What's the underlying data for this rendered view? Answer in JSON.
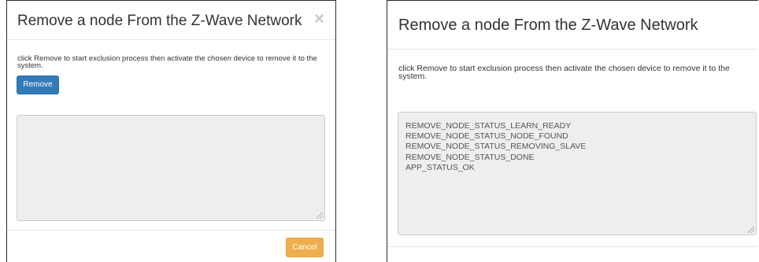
{
  "colors": {
    "primary": "#337ab7",
    "warning": "#f0ad4e",
    "log_bg": "#eeeeee"
  },
  "left_modal": {
    "title": "Remove a node From the Z-Wave Network",
    "close_icon": "close-icon",
    "close_glyph": "×",
    "instruction": "click Remove to start exclusion process then activate the chosen device to remove it to the system.",
    "remove_label": "Remove",
    "log_lines": [],
    "cancel_label": "Cancel"
  },
  "right_modal": {
    "title": "Remove a node From the Z-Wave Network",
    "instruction": "click Remove to start exclusion process then activate the chosen device to remove it to the system.",
    "log_lines": [
      "REMOVE_NODE_STATUS_LEARN_READY",
      "REMOVE_NODE_STATUS_NODE_FOUND",
      "REMOVE_NODE_STATUS_REMOVING_SLAVE",
      "REMOVE_NODE_STATUS_DONE",
      "APP_STATUS_OK"
    ]
  }
}
